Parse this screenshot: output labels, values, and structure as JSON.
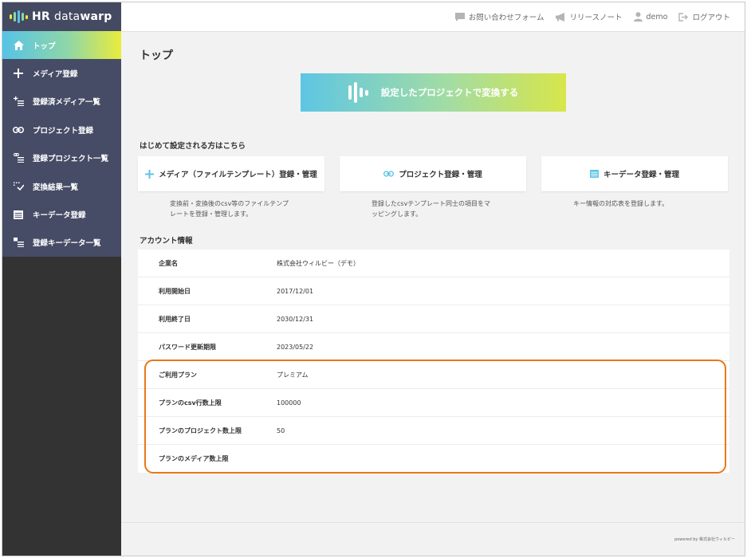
{
  "app": {
    "logo_strong": "HR",
    "logo_light": "data",
    "logo_bold2": "warp"
  },
  "colors": {
    "sidebar_bg": "#333333",
    "nav_bg": "#464c66",
    "logo_bg": "#444a61",
    "accent_cyan": "#5ec6e3",
    "accent_yellow": "#d7e64a",
    "highlight_border": "#e87817"
  },
  "sidebar": {
    "items": [
      {
        "label": "トップ",
        "icon": "home-icon",
        "active": true
      },
      {
        "label": "メディア登録",
        "icon": "plus-icon"
      },
      {
        "label": "登録済メディア一覧",
        "icon": "plus-list-icon"
      },
      {
        "label": "プロジェクト登録",
        "icon": "link-icon"
      },
      {
        "label": "登録プロジェクト一覧",
        "icon": "link-list-icon"
      },
      {
        "label": "変換結果一覧",
        "icon": "check-list-icon"
      },
      {
        "label": "キーデータ登録",
        "icon": "table-icon"
      },
      {
        "label": "登録キーデータ一覧",
        "icon": "table-list-icon"
      }
    ]
  },
  "header": {
    "contact": "お問い合わせフォーム",
    "release_notes": "リリースノート",
    "user": "demo",
    "logout": "ログアウト"
  },
  "main": {
    "title": "トップ",
    "convert_button": "設定したプロジェクトで変換する",
    "first_time_title": "はじめて設定される方はこちら",
    "cards": [
      {
        "label": "メディア（ファイルテンプレート）登録・管理",
        "icon": "plus-icon",
        "desc_line1": "変換前・変換後のcsv等のファイルテンプ",
        "desc_line2": "レートを登録・管理します。"
      },
      {
        "label": "プロジェクト登録・管理",
        "icon": "link-icon",
        "desc_line1": "登録したcsvテンプレート同士の項目をマ",
        "desc_line2": "ッピングします。"
      },
      {
        "label": "キーデータ登録・管理",
        "icon": "table-icon",
        "desc_line1": "キー情報の対応表を登録します。",
        "desc_line2": ""
      }
    ],
    "account_title": "アカウント情報",
    "account_rows": [
      {
        "label": "企業名",
        "value": "株式会社ウィルビー（デモ）"
      },
      {
        "label": "利用開始日",
        "value": "2017/12/01"
      },
      {
        "label": "利用終了日",
        "value": "2030/12/31"
      },
      {
        "label": "パスワード更新期限",
        "value": "2023/05/22"
      },
      {
        "label": "ご利用プラン",
        "value": "プレミアム"
      },
      {
        "label": "プランのcsv行数上限",
        "value": "100000"
      },
      {
        "label": "プランのプロジェクト数上限",
        "value": "50"
      },
      {
        "label": "プランのメディア数上限",
        "value": ""
      }
    ]
  },
  "footer": {
    "powered_by": "powered by 株式会社ウィルビー"
  }
}
